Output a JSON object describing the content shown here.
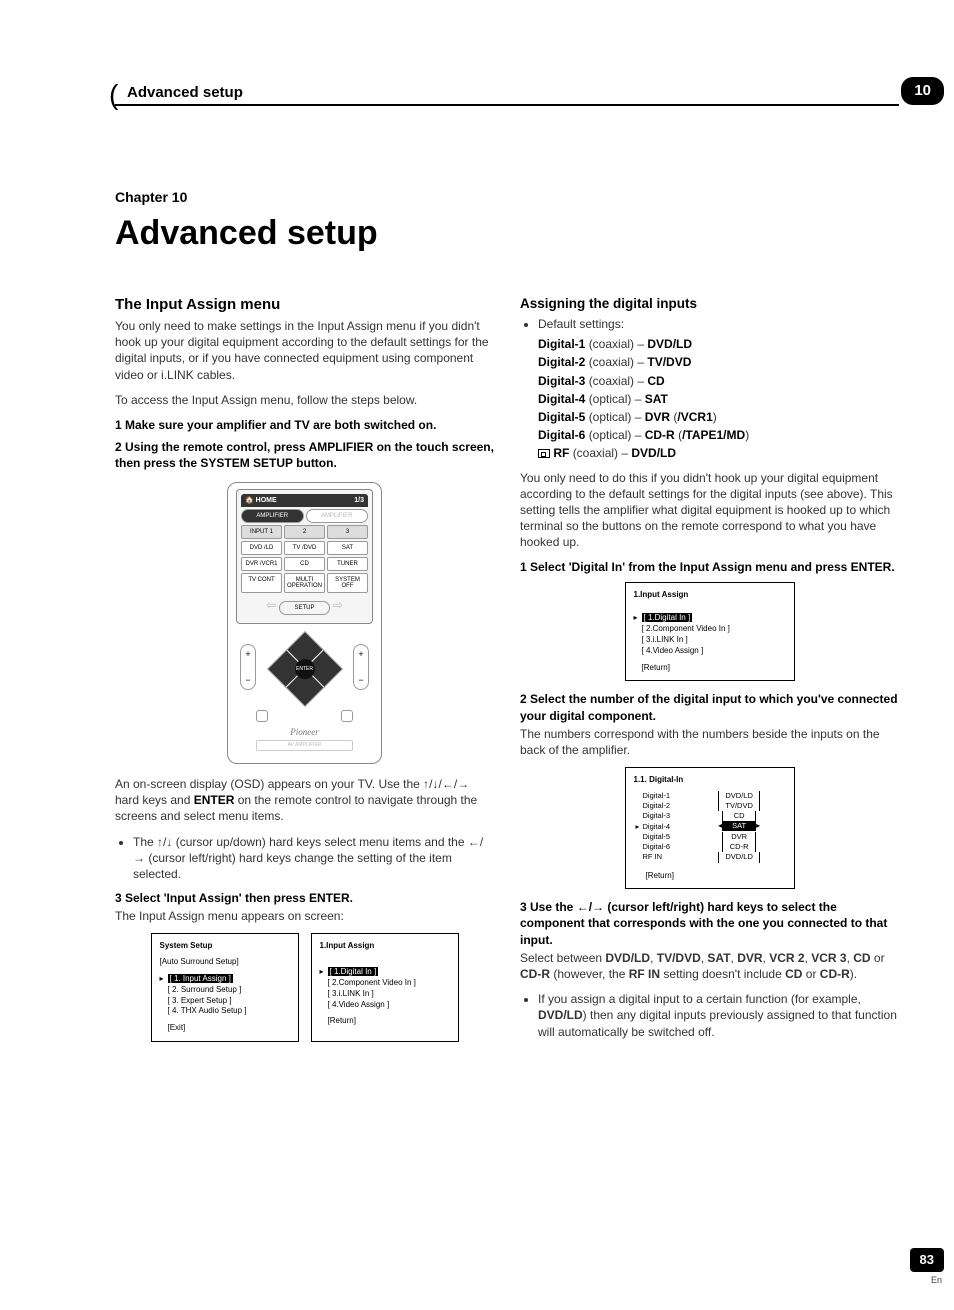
{
  "header": {
    "label": "Advanced setup",
    "chapter_num": "10"
  },
  "chapter_line": "Chapter 10",
  "title": "Advanced setup",
  "left": {
    "section_title": "The Input Assign menu",
    "intro": "You only need to make settings in the Input Assign menu if you didn't hook up your digital equipment according to the default settings for the digital inputs, or if you have connected equipment using component video or i.LINK cables.",
    "access": "To access the Input Assign menu, follow the steps below.",
    "step1": "1    Make sure your amplifier and TV are both switched on.",
    "step2": "2    Using the remote control, press AMPLIFIER on the touch screen, then press the SYSTEM SETUP button.",
    "remote": {
      "home": "HOME",
      "ratio": "1/3",
      "amplifier_active": "AMPLIFIER",
      "amplifier_ghost": "AMPLIFIER",
      "input1": "INPUT 1",
      "input2": "2",
      "input3": "3",
      "dvd": "DVD\n/LD",
      "tv": "TV\n/DVD",
      "sat": "SAT",
      "dvr": "DVR\n/VCR1",
      "cd": "CD",
      "tuner": "TUNER",
      "tvcont": "TV\nCONT",
      "multi": "MULTI\nOPERATION",
      "sysoff": "SYSTEM\nOFF",
      "setup": "SETUP",
      "enter": "ENTER",
      "brand": "Pioneer",
      "model": "AV AMPLIFIER"
    },
    "osd_para_prefix": "An on-screen display (OSD) appears on your TV. Use the ",
    "osd_para_mid": " hard keys and ",
    "osd_enter": "ENTER",
    "osd_para_suffix": " on the remote control to navigate through the screens and select menu items.",
    "bullet1_prefix": "The ",
    "bullet1_mid": " (cursor up/down) hard keys select menu items and the ",
    "bullet1_suffix": " (cursor left/right) hard keys change the setting of the item selected.",
    "step3": "3    Select 'Input Assign' then press ENTER.",
    "step3_sub": "The Input Assign menu appears on screen:",
    "menu_a": {
      "title": "System Setup",
      "sub": "[Auto Surround Setup]",
      "items": [
        "[ 1. Input Assign ]",
        "[ 2. Surround Setup ]",
        "[ 3. Expert Setup ]",
        "[ 4. THX Audio Setup ]"
      ],
      "highlight_idx": 0,
      "foot": "[Exit]"
    },
    "menu_b": {
      "title": "1.Input Assign",
      "items": [
        "[ 1.Digital In ]",
        "[ 2.Component Video In ]",
        "[ 3.i.LINK In ]",
        "[ 4.Video Assign ]"
      ],
      "highlight_idx": 0,
      "foot": "[Return]"
    }
  },
  "right": {
    "section_title": "Assigning the digital inputs",
    "defaults_label": "Default settings:",
    "defaults": [
      {
        "name": "Digital-1",
        "type": "(coaxial)",
        "val": "DVD/LD"
      },
      {
        "name": "Digital-2",
        "type": "(coaxial)",
        "val": "TV/DVD"
      },
      {
        "name": "Digital-3",
        "type": "(coaxial)",
        "val": "CD"
      },
      {
        "name": "Digital-4",
        "type": "(optical)",
        "val": "SAT"
      },
      {
        "name": "Digital-5",
        "type": "(optical)",
        "val": "DVR",
        "val2": "(/VCR1)"
      },
      {
        "name": "Digital-6",
        "type": "(optical)",
        "val": "CD-R",
        "val2": "(/TAPE1/MD)"
      }
    ],
    "rf_line_label": "RF",
    "rf_line_type": "(coaxial)",
    "rf_line_val": "DVD/LD",
    "para1": "You only need to do this if you didn't hook up your digital equipment according to the default settings for the digital inputs (see above). This setting tells the amplifier what digital equipment is hooked up to which terminal so the buttons on the remote correspond to what you have hooked up.",
    "step1": "1    Select 'Digital In' from the Input Assign menu and press ENTER.",
    "menu_c": {
      "title": "1.Input Assign",
      "items": [
        "[ 1.Digital In ]",
        "[ 2.Component Video In ]",
        "[ 3.i.LINK In ]",
        "[ 4.Video Assign ]"
      ],
      "highlight_idx": 0,
      "foot": "[Return]"
    },
    "step2": "2    Select the number of the digital input to which you've connected your digital component.",
    "step2_sub": "The numbers correspond with the numbers beside the inputs on the back of the amplifier.",
    "menu_d": {
      "title": "1.1. Digital-In",
      "rows": [
        {
          "k": "Digital-1",
          "v": "DVD/LD"
        },
        {
          "k": "Digital-2",
          "v": "TV/DVD"
        },
        {
          "k": "Digital-3",
          "v": "CD"
        },
        {
          "k": "Digital-4",
          "v": "SAT",
          "hl": true,
          "ptr": true,
          "lr": true
        },
        {
          "k": "Digital-5",
          "v": "DVR"
        },
        {
          "k": "Digital-6",
          "v": "CD-R"
        },
        {
          "k": "RF IN",
          "v": "DVD/LD"
        }
      ],
      "foot": "[Return]"
    },
    "step3_prefix": "3    Use the ",
    "step3_suffix": " (cursor left/right) hard keys to select the component that corresponds with the one you connected to that input.",
    "para2_a": "Select between ",
    "para2_list": "DVD/LD, TV/DVD, SAT, DVR, VCR 2, VCR 3, CD",
    "para2_or": " or ",
    "para2_cdr": "CD-R",
    "para2_b": " (however, the ",
    "para2_rf": "RF IN",
    "para2_c": " setting doesn't include ",
    "para2_cd": "CD",
    "para2_or2": " or ",
    "para2_cdr2": "CD-R",
    "para2_end": ").",
    "bullet_a": "If you assign a digital input to a certain function (for example, ",
    "bullet_bold": "DVD/LD",
    "bullet_b": ") then any digital inputs previously assigned to that function will automatically be switched off."
  },
  "footer": {
    "page": "83",
    "lang": "En"
  }
}
